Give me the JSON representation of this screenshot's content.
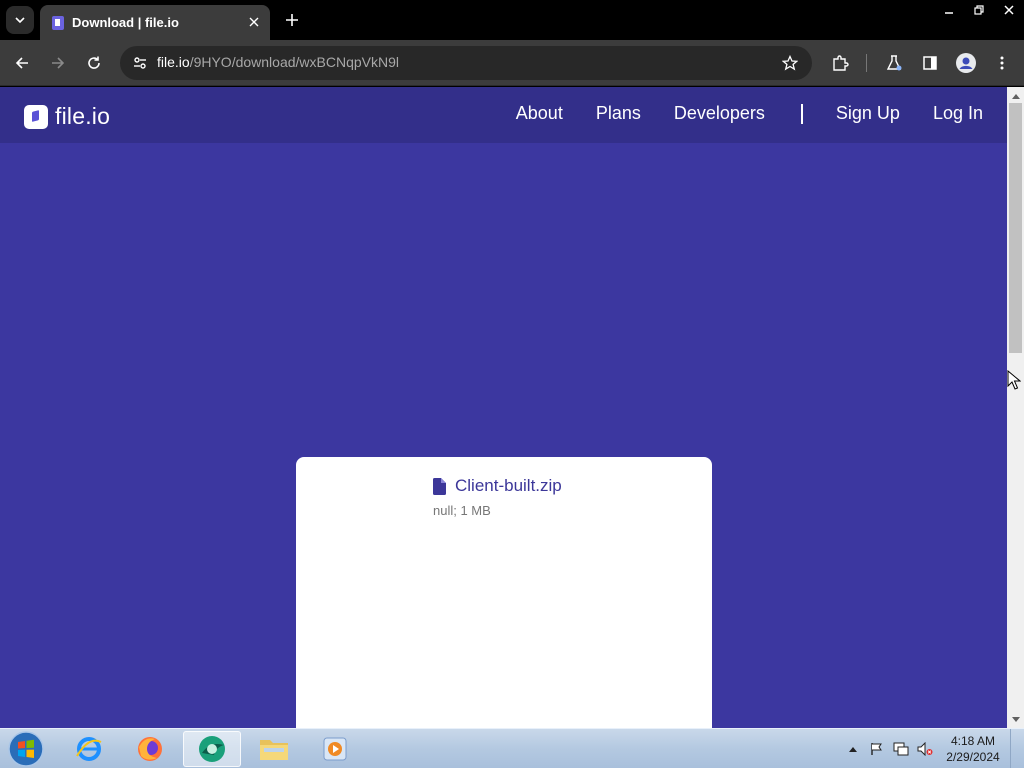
{
  "browser": {
    "tab_title": "Download | file.io",
    "url_host": "file.io",
    "url_path": "/9HYO/download/wxBCNqpVkN9l"
  },
  "site": {
    "logo_text": "file.io",
    "nav": {
      "about": "About",
      "plans": "Plans",
      "developers": "Developers",
      "sign_up": "Sign Up",
      "log_in": "Log In"
    }
  },
  "download": {
    "file_name": "Client-built.zip",
    "file_meta": "null; 1 MB"
  },
  "taskbar": {
    "time": "4:18 AM",
    "date": "2/29/2024"
  },
  "colors": {
    "page_background": "#3c37a0",
    "nav_background": "#332f8a",
    "accent": "#3c3799"
  }
}
